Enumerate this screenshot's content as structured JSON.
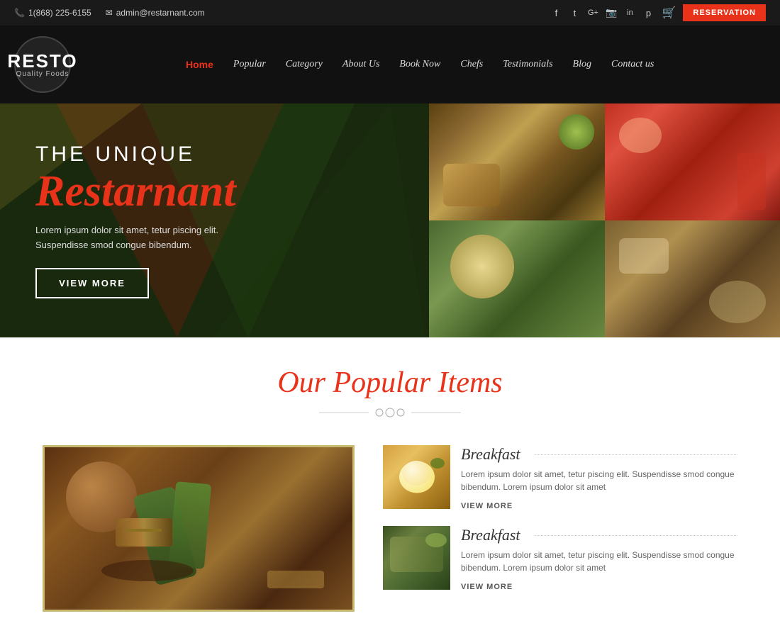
{
  "topbar": {
    "phone_icon": "📞",
    "phone": "1(868) 225-6155",
    "email_icon": "✉",
    "email": "admin@restarnant.com",
    "social": [
      "f",
      "t",
      "G+",
      "📷",
      "in",
      "p"
    ],
    "cart_icon": "🛒",
    "reservation_label": "RESERVATION"
  },
  "navbar": {
    "logo_main": "RESTO",
    "logo_sub": "Quality Foods",
    "links": [
      {
        "label": "Home",
        "active": true
      },
      {
        "label": "Popular",
        "active": false
      },
      {
        "label": "Category",
        "active": false
      },
      {
        "label": "About Us",
        "active": false
      },
      {
        "label": "Book Now",
        "active": false
      },
      {
        "label": "Chefs",
        "active": false
      },
      {
        "label": "Testimonials",
        "active": false
      },
      {
        "label": "Blog",
        "active": false
      },
      {
        "label": "Contact us",
        "active": false
      }
    ]
  },
  "hero": {
    "the_unique": "THE UNIQUE",
    "restaurant": "Restarnant",
    "description_line1": "Lorem ipsum dolor sit amet, tetur piscing elit.",
    "description_line2": "Suspendisse smod congue bibendum.",
    "view_more": "VIEW MORE"
  },
  "popular_section": {
    "title": "Our Popular Items",
    "divider": "❧❦❧",
    "items": [
      {
        "title": "Breakfast",
        "description": "Lorem ipsum dolor sit amet, tetur piscing elit. Suspendisse smod congue bibendum. Lorem ipsum dolor sit amet",
        "view_more": "VIEW MORE"
      },
      {
        "title": "Breakfast",
        "description": "Lorem ipsum dolor sit amet, tetur piscing elit. Suspendisse smod congue bibendum. Lorem ipsum dolor sit amet",
        "view_more": "VIEW MORE"
      }
    ]
  }
}
